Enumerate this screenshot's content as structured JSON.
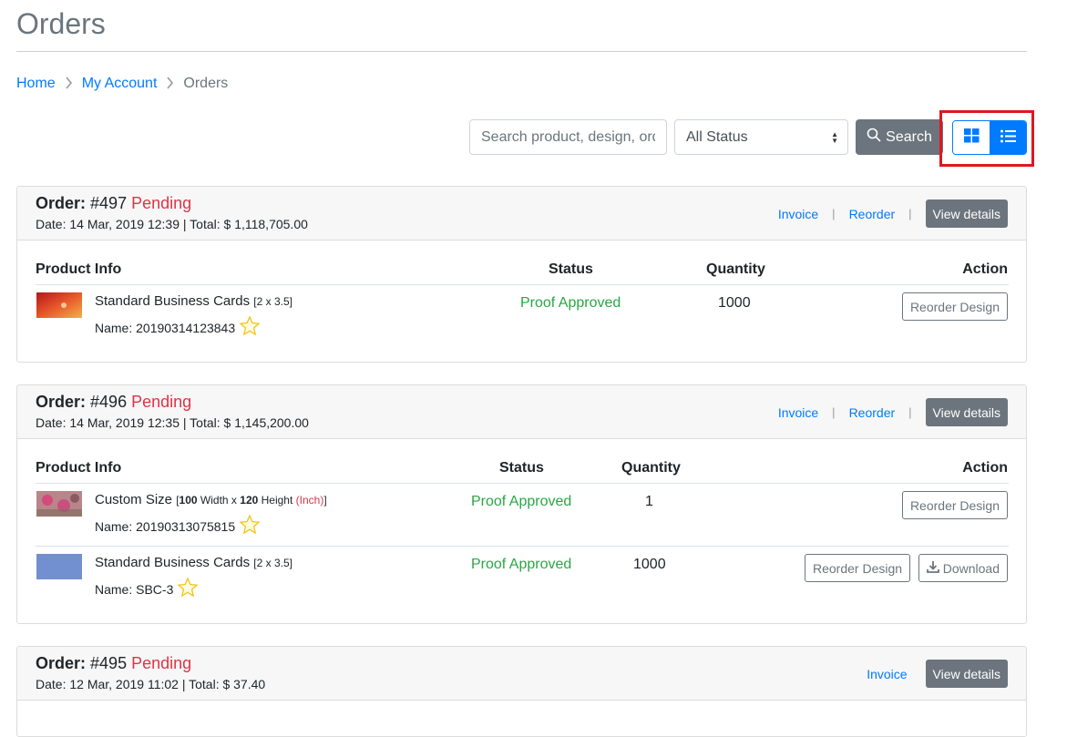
{
  "page": {
    "title": "Orders"
  },
  "breadcrumb": [
    {
      "label": "Home"
    },
    {
      "label": "My Account"
    },
    {
      "label": "Orders"
    }
  ],
  "toolbar": {
    "search_placeholder": "Search product, design, order",
    "status_selected": "All Status",
    "search_label": "Search"
  },
  "orders": [
    {
      "label": "Order:",
      "number": "#497",
      "status": "Pending",
      "meta": "Date: 14 Mar, 2019 12:39 | Total: $ 1,118,705.00",
      "invoice": "Invoice",
      "reorder": "Reorder",
      "view_details": "View details",
      "headers": {
        "product": "Product Info",
        "status": "Status",
        "quantity": "Quantity",
        "action": "Action"
      },
      "items": [
        {
          "product": "Standard Business Cards",
          "size": "[2 x 3.5]",
          "design": "Name: 20190314123843",
          "status": "Proof Approved",
          "quantity": "1000",
          "reorder_design": "Reorder Design"
        }
      ]
    },
    {
      "label": "Order:",
      "number": "#496",
      "status": "Pending",
      "meta": "Date: 14 Mar, 2019 12:35 | Total: $ 1,145,200.00",
      "invoice": "Invoice",
      "reorder": "Reorder",
      "view_details": "View details",
      "headers": {
        "product": "Product Info",
        "status": "Status",
        "quantity": "Quantity",
        "action": "Action"
      },
      "items": [
        {
          "product": "Custom Size",
          "size_open": "[",
          "size_w": "100",
          "size_w_label": " Width x ",
          "size_h": "120",
          "size_h_label": " Height ",
          "size_unit": "(Inch)",
          "size_close": "]",
          "design": "Name: 20190313075815",
          "status": "Proof Approved",
          "quantity": "1",
          "reorder_design": "Reorder Design"
        },
        {
          "product": "Standard Business Cards",
          "size": "[2 x 3.5]",
          "design": "Name: SBC-3",
          "status": "Proof Approved",
          "quantity": "1000",
          "reorder_design": "Reorder Design",
          "download": "Download"
        }
      ]
    },
    {
      "label": "Order:",
      "number": "#495",
      "status": "Pending",
      "meta": "Date: 12 Mar, 2019 11:02 | Total: $ 37.40",
      "invoice": "Invoice",
      "view_details": "View details"
    }
  ],
  "colors": {
    "link": "#007bff",
    "pending": "#dc3545",
    "approved": "#28a745",
    "highlight": "#e01620",
    "secondary": "#6c757d"
  },
  "icons": [
    "chevron-right-icon",
    "search-icon",
    "grid-view-icon",
    "list-view-icon",
    "star-icon",
    "download-icon",
    "select-arrows-icon"
  ]
}
